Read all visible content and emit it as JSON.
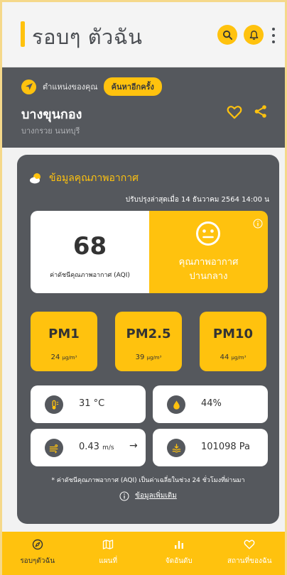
{
  "header": {
    "title": "รอบๆ ตัวฉัน",
    "search_icon": "search-icon",
    "bell_icon": "bell-icon",
    "menu_icon": "more-vertical-icon"
  },
  "location": {
    "label": "ตำแหน่งของคุณ",
    "search_again": "ค้นหาอีกครั้ง",
    "name": "บางขุนกอง",
    "sub": "บางกรวย นนทบุรี"
  },
  "air": {
    "title": "ข้อมูลคุณภาพอากาศ",
    "updated": "ปรับปรุงล่าสุดเมื่อ 14 ธันวาคม 2564 14:00 น",
    "aqi_value": "68",
    "aqi_label": "ค่าดัชนีคุณภาพอากาศ (AQI)",
    "quality_line1": "คุณภาพอากาศ",
    "quality_line2": "ปานกลาง",
    "pm": [
      {
        "name": "PM1",
        "value": "24",
        "unit": "μg/m³"
      },
      {
        "name": "PM2.5",
        "value": "39",
        "unit": "μg/m³"
      },
      {
        "name": "PM10",
        "value": "44",
        "unit": "μg/m³"
      }
    ],
    "temperature": "31 °C",
    "humidity": "44%",
    "wind_value": "0.43",
    "wind_unit": "m/s",
    "pressure": "101098 Pa",
    "note": "* ค่าดัชนีคุณภาพอากาศ (AQI) เป็นค่าเฉลี่ยในช่วง 24 ชั่วโมงที่ผ่านมา",
    "more_info": "ข้อมูลเพิ่มเติม"
  },
  "nav": [
    {
      "label": "รอบๆตัวฉัน",
      "icon": "compass-icon"
    },
    {
      "label": "แผนที่",
      "icon": "map-icon"
    },
    {
      "label": "จัดอันดับ",
      "icon": "ranking-icon"
    },
    {
      "label": "สถานที่ของฉัน",
      "icon": "heart-icon"
    }
  ],
  "colors": {
    "accent": "#ffc20e",
    "dark": "#55585d"
  }
}
